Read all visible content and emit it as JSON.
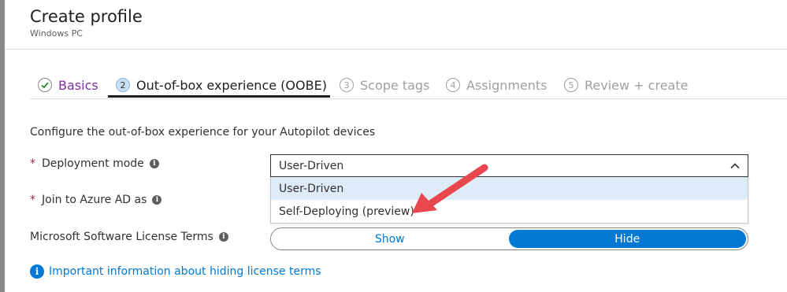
{
  "header": {
    "title": "Create profile",
    "subtitle": "Windows PC"
  },
  "tabs": [
    {
      "badge": "✓",
      "label": "Basics",
      "state": "done"
    },
    {
      "badge": "2",
      "label": "Out-of-box experience (OOBE)",
      "state": "active"
    },
    {
      "badge": "3",
      "label": "Scope tags",
      "state": "disabled"
    },
    {
      "badge": "4",
      "label": "Assignments",
      "state": "disabled"
    },
    {
      "badge": "5",
      "label": "Review + create",
      "state": "disabled"
    }
  ],
  "description": "Configure the out-of-box experience for your Autopilot devices",
  "fields": {
    "deployment_mode": {
      "required": "*",
      "label": "Deployment mode",
      "value": "User-Driven",
      "options": [
        "User-Driven",
        "Self-Deploying (preview)"
      ]
    },
    "join_azure": {
      "required": "*",
      "label": "Join to Azure AD as"
    },
    "license_terms": {
      "label": "Microsoft Software License Terms",
      "options": [
        "Show",
        "Hide"
      ],
      "selected": "Hide"
    }
  },
  "info_link": {
    "icon": "i",
    "text": "Important information about hiding license terms"
  },
  "info_icon_glyph": "i",
  "colors": {
    "accent": "#0078d4",
    "required": "#a4262c",
    "arrow": "#e8484d",
    "completed_tab": "#7c2fa0"
  }
}
